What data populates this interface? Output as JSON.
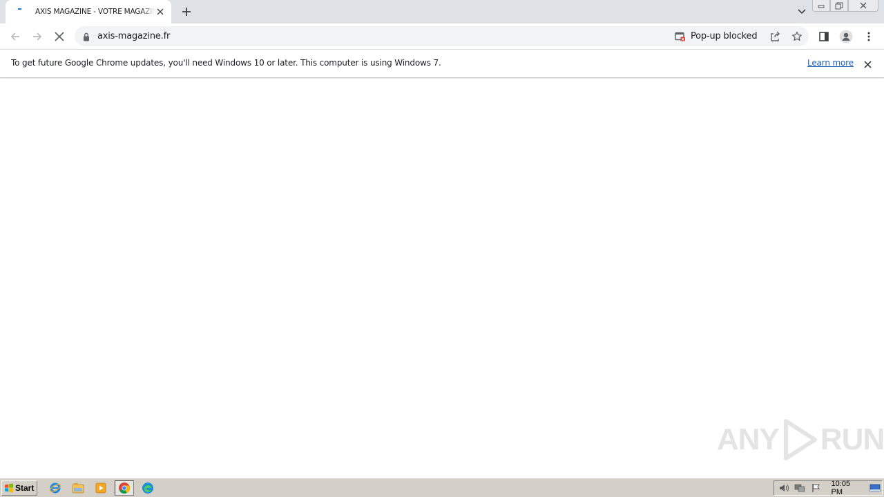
{
  "browser": {
    "tab": {
      "title": "AXIS MAGAZINE - VOTRE MAGAZINE",
      "close_icon": "close-icon"
    },
    "new_tab_icon": "plus-icon",
    "tab_search_icon": "chevron-down-icon",
    "window_controls": {
      "minimize_icon": "minimize-icon",
      "restore_icon": "restore-icon",
      "close_icon": "close-icon"
    }
  },
  "toolbar": {
    "back_icon": "back-arrow-icon",
    "forward_icon": "forward-arrow-icon",
    "stop_icon": "stop-loading-icon",
    "url": "axis-magazine.fr",
    "popup_blocked_label": "Pop-up blocked",
    "share_icon": "share-icon",
    "bookmark_icon": "star-icon",
    "side_panel_icon": "side-panel-icon",
    "profile_icon": "profile-avatar-icon",
    "menu_icon": "kebab-menu-icon"
  },
  "infobar": {
    "message": "To get future Google Chrome updates, you'll need Windows 10 or later. This computer is using Windows 7.",
    "link_label": "Learn more"
  },
  "watermark": {
    "text_left": "ANY",
    "text_right": "RUN"
  },
  "taskbar": {
    "start_label": "Start",
    "apps": [
      "internet-explorer-icon",
      "file-explorer-icon",
      "media-player-icon",
      "chrome-icon",
      "edge-icon"
    ],
    "clock": "10:05 PM"
  },
  "colors": {
    "tabstrip_bg": "#dee1e6",
    "omnibox_bg": "#f1f3f4",
    "link": "#1a5fb4",
    "taskbar_bg": "#d4d0c8"
  }
}
